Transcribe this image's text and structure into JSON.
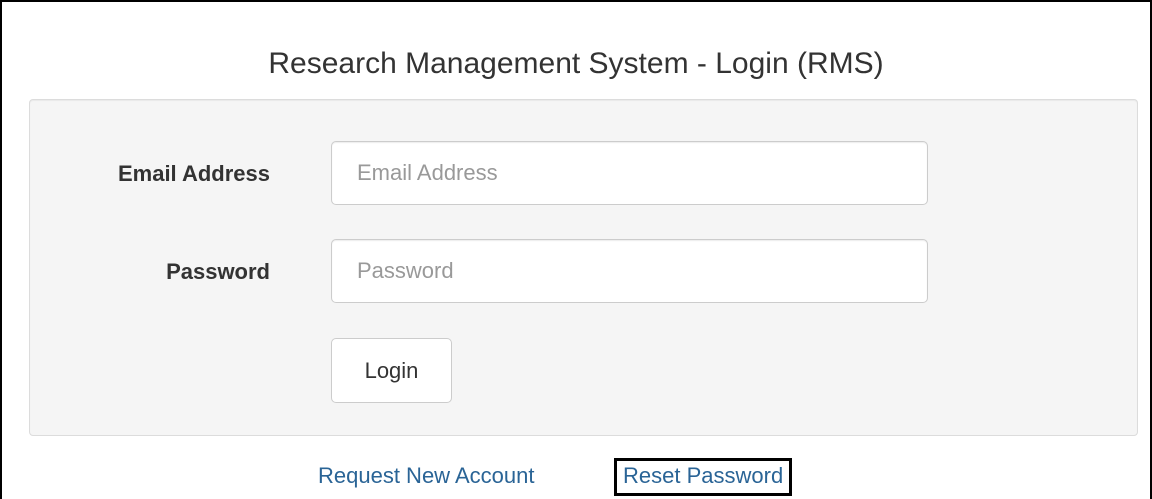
{
  "page": {
    "title": "Research Management System - Login (RMS)"
  },
  "form": {
    "email": {
      "label": "Email Address",
      "placeholder": "Email Address",
      "value": ""
    },
    "password": {
      "label": "Password",
      "placeholder": "Password",
      "value": ""
    },
    "login_label": "Login"
  },
  "links": {
    "request_account": "Request New Account",
    "reset_password": "Reset Password"
  },
  "colors": {
    "link": "#2a6496",
    "well_background": "#f5f5f5",
    "text": "#333333",
    "highlight_border": "#000000"
  }
}
